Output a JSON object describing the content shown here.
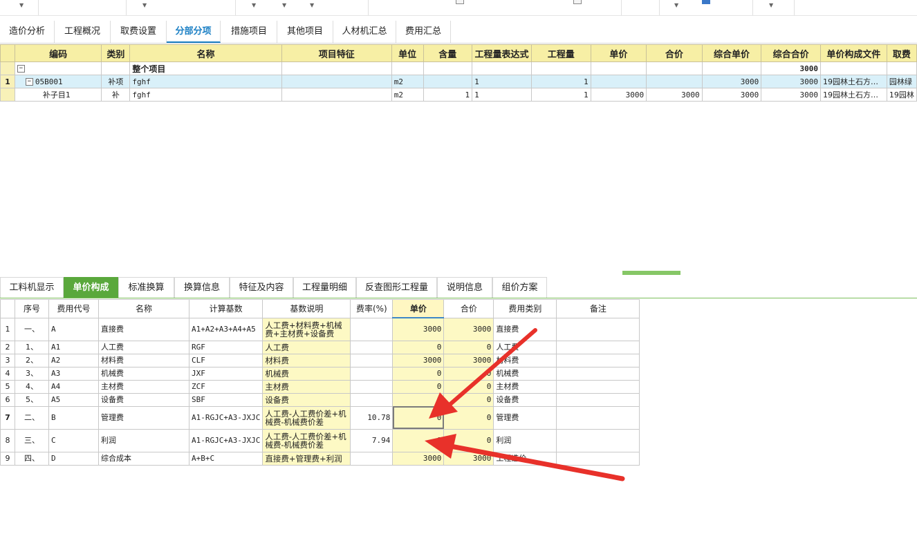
{
  "top_tabs": [
    "造价分析",
    "工程概况",
    "取费设置",
    "分部分项",
    "措施项目",
    "其他项目",
    "人材机汇总",
    "费用汇总"
  ],
  "grid1": {
    "headers": [
      "编码",
      "类别",
      "名称",
      "项目特征",
      "单位",
      "含量",
      "工程量表达式",
      "工程量",
      "单价",
      "合价",
      "综合单价",
      "综合合价",
      "单价构成文件",
      "取费"
    ],
    "summary": {
      "expander": "−",
      "name": "整个项目",
      "total": "3000"
    },
    "rows": [
      {
        "rownum": "1",
        "expander": "−",
        "code": "05B001",
        "type": "补项",
        "name": "fghf",
        "feature": "",
        "unit": "m2",
        "content": "",
        "expr": "1",
        "qty": "1",
        "price": "",
        "amount": "",
        "comp_price": "3000",
        "comp_amount": "3000",
        "file": "19园林土石方…",
        "fee": "园林绿"
      },
      {
        "rownum": "",
        "code": "补子目1",
        "type": "补",
        "name": "fghf",
        "feature": "",
        "unit": "m2",
        "content": "1",
        "expr": "1",
        "qty": "1",
        "price": "3000",
        "amount": "3000",
        "comp_price": "3000",
        "comp_amount": "3000",
        "file": "19园林土石方…",
        "fee": "19园林"
      }
    ]
  },
  "bottom_tabs": [
    "工料机显示",
    "单价构成",
    "标准换算",
    "换算信息",
    "特征及内容",
    "工程量明细",
    "反查图形工程量",
    "说明信息",
    "组价方案"
  ],
  "grid2": {
    "headers": [
      "序号",
      "费用代号",
      "名称",
      "计算基数",
      "基数说明",
      "费率(%)",
      "单价",
      "合价",
      "费用类别",
      "备注"
    ],
    "rows": [
      {
        "n": "1",
        "seq": "一、",
        "code": "A",
        "name": "直接费",
        "base": "A1+A2+A3+A4+A5",
        "desc": "人工费+材料费+机械费+主材费+设备费",
        "rate": "",
        "price": "3000",
        "amount": "3000",
        "cat": "直接费",
        "note": ""
      },
      {
        "n": "2",
        "seq": "1、",
        "code": "A1",
        "name": "人工费",
        "base": "RGF",
        "desc": "人工费",
        "rate": "",
        "price": "0",
        "amount": "0",
        "cat": "人工费",
        "note": ""
      },
      {
        "n": "3",
        "seq": "2、",
        "code": "A2",
        "name": "材料费",
        "base": "CLF",
        "desc": "材料费",
        "rate": "",
        "price": "3000",
        "amount": "3000",
        "cat": "材料费",
        "note": ""
      },
      {
        "n": "4",
        "seq": "3、",
        "code": "A3",
        "name": "机械费",
        "base": "JXF",
        "desc": "机械费",
        "rate": "",
        "price": "0",
        "amount": "0",
        "cat": "机械费",
        "note": ""
      },
      {
        "n": "5",
        "seq": "4、",
        "code": "A4",
        "name": "主材费",
        "base": "ZCF",
        "desc": "主材费",
        "rate": "",
        "price": "0",
        "amount": "0",
        "cat": "主材费",
        "note": ""
      },
      {
        "n": "6",
        "seq": "5、",
        "code": "A5",
        "name": "设备费",
        "base": "SBF",
        "desc": "设备费",
        "rate": "",
        "price": "0",
        "amount": "0",
        "cat": "设备费",
        "note": ""
      },
      {
        "n": "7",
        "seq": "二、",
        "code": "B",
        "name": "管理费",
        "base": "A1-RGJC+A3-JXJC",
        "desc": "人工费-人工费价差+机械费-机械费价差",
        "rate": "10.78",
        "price": "0",
        "amount": "0",
        "cat": "管理费",
        "note": ""
      },
      {
        "n": "8",
        "seq": "三、",
        "code": "C",
        "name": "利润",
        "base": "A1-RGJC+A3-JXJC",
        "desc": "人工费-人工费价差+机械费-机械费价差",
        "rate": "7.94",
        "price": "0",
        "amount": "0",
        "cat": "利润",
        "note": ""
      },
      {
        "n": "9",
        "seq": "四、",
        "code": "D",
        "name": "综合成本",
        "base": "A+B+C",
        "desc": "直接费+管理费+利润",
        "rate": "",
        "price": "3000",
        "amount": "3000",
        "cat": "工程造价",
        "note": ""
      }
    ]
  },
  "colors": {
    "header_yellow": "#f7efa5",
    "active_tab_blue": "#1a7fc4",
    "active_tab_green": "#5aa83c",
    "arrow_red": "#e8312a"
  }
}
